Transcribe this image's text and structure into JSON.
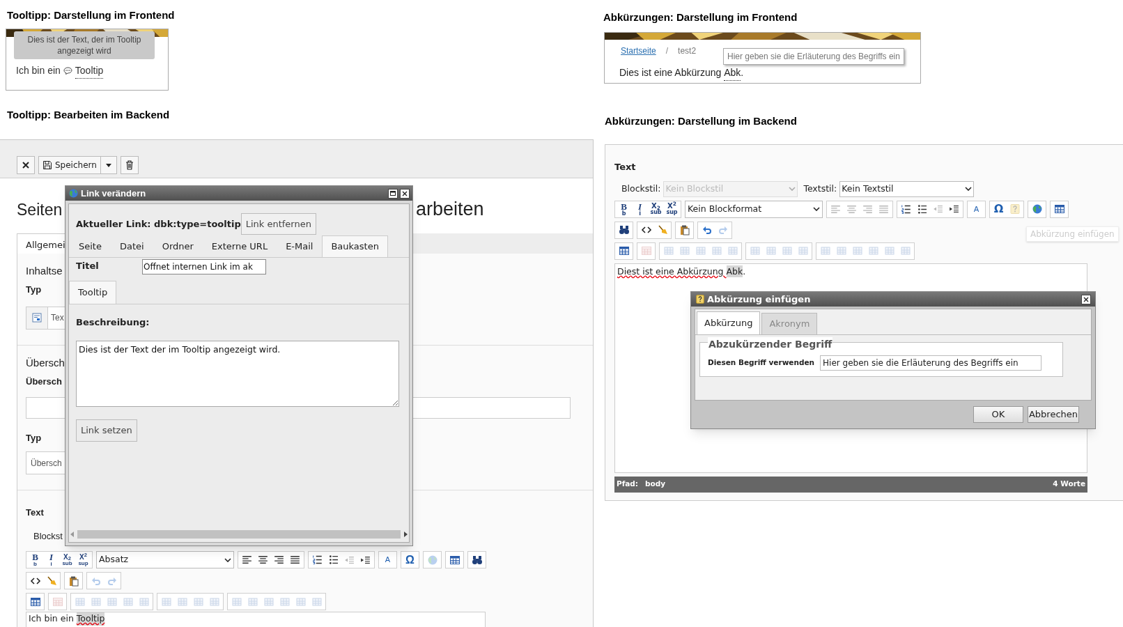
{
  "tooltip_frontend": {
    "heading": "Tooltipp: Darstellung im Frontend",
    "tooltip": "Dies ist der Text, der im Tooltip angezeigt wird",
    "text": "Ich bin ein",
    "link": "Tooltip"
  },
  "tooltip_backend": {
    "heading": "Tooltipp: Bearbeiten im Backend",
    "save_label": "Speichern",
    "page_title_start": "Seiten",
    "page_title_end": "arbeiten",
    "tab": "Allgemei",
    "section_1_title": "Inhaltse",
    "type_label": "Typ",
    "type_value": "Tex",
    "section_2_title": "Übersch",
    "header_label": "Übersch",
    "type_label_2": "Typ",
    "type_value_2": "Übersch",
    "text_label": "Text",
    "blockstyle_label": "Blockst",
    "toolbar": [
      [
        {
          "kind": "group",
          "buttons": [
            {
              "kind": "bold",
              "label": "B",
              "sub": "b",
              "disabled": false
            },
            {
              "kind": "italic",
              "label": "I",
              "sub": "i",
              "disabled": false
            },
            {
              "kind": "subscript",
              "label": "X$_{2}$",
              "sub": "sub",
              "disabled": false
            },
            {
              "kind": "superscript",
              "label": "X$^{2}$",
              "sub": "sup",
              "disabled": false
            }
          ]
        },
        {
          "kind": "select",
          "value": "Absatz"
        },
        {
          "kind": "group",
          "buttons": [
            {
              "kind": "align-left",
              "disabled": false
            },
            {
              "kind": "align-center",
              "disabled": false
            },
            {
              "kind": "align-right",
              "disabled": false
            },
            {
              "kind": "justify",
              "disabled": false
            }
          ]
        },
        {
          "kind": "group",
          "buttons": [
            {
              "kind": "ordered-list",
              "disabled": false
            },
            {
              "kind": "bullet-list",
              "disabled": false
            },
            {
              "kind": "outdent",
              "disabled": true
            },
            {
              "kind": "indent",
              "disabled": false
            }
          ]
        },
        {
          "kind": "group",
          "buttons": [
            {
              "kind": "text-color",
              "label": "A",
              "disabled": false
            }
          ]
        },
        {
          "kind": "group",
          "buttons": [
            {
              "kind": "special-char",
              "label": "Ω",
              "disabled": false
            }
          ]
        },
        {
          "kind": "group",
          "buttons": [
            {
              "kind": "globe",
              "disabled": true
            }
          ]
        },
        {
          "kind": "group",
          "buttons": [
            {
              "kind": "table",
              "disabled": false
            }
          ]
        },
        {
          "kind": "group",
          "buttons": [
            {
              "kind": "find",
              "disabled": false
            }
          ]
        }
      ],
      [
        {
          "kind": "group",
          "buttons": [
            {
              "kind": "source",
              "disabled": false
            },
            {
              "kind": "clean",
              "disabled": false
            }
          ]
        },
        {
          "kind": "group",
          "buttons": [
            {
              "kind": "paste",
              "disabled": false
            }
          ]
        },
        {
          "kind": "group",
          "buttons": [
            {
              "kind": "undo",
              "disabled": true
            },
            {
              "kind": "redo",
              "disabled": true
            }
          ]
        }
      ],
      [
        {
          "kind": "group",
          "buttons": [
            {
              "kind": "table",
              "disabled": false
            }
          ]
        },
        {
          "kind": "group",
          "buttons": [
            {
              "kind": "table-delete",
              "disabled": true
            }
          ]
        },
        {
          "kind": "group",
          "buttons": [
            {
              "kind": "table-op",
              "disabled": true
            },
            {
              "kind": "table-op",
              "disabled": true
            },
            {
              "kind": "table-op",
              "disabled": true
            },
            {
              "kind": "table-op",
              "disabled": true
            },
            {
              "kind": "table-op",
              "disabled": true
            }
          ]
        },
        {
          "kind": "group",
          "buttons": [
            {
              "kind": "table-op",
              "disabled": true
            },
            {
              "kind": "table-op",
              "disabled": true
            },
            {
              "kind": "table-op",
              "disabled": true
            },
            {
              "kind": "table-op",
              "disabled": true
            }
          ]
        },
        {
          "kind": "group",
          "buttons": [
            {
              "kind": "table-op",
              "disabled": true
            },
            {
              "kind": "table-op",
              "disabled": true
            },
            {
              "kind": "table-op",
              "disabled": true
            },
            {
              "kind": "table-op",
              "disabled": true
            },
            {
              "kind": "table-op",
              "disabled": true
            },
            {
              "kind": "table-op",
              "disabled": true
            }
          ]
        }
      ]
    ],
    "editor_text": "Ich bin ein",
    "editor_link": "Tooltip",
    "dialog": {
      "title": "Link verändern",
      "current_link": "Aktueller Link: dbk:type=tooltip",
      "remove_button": "Link entfernen",
      "tabs": [
        {
          "label": "Seite",
          "selected": false
        },
        {
          "label": "Datei",
          "selected": false
        },
        {
          "label": "Ordner",
          "selected": false
        },
        {
          "label": "Externe URL",
          "selected": false
        },
        {
          "label": "E-Mail",
          "selected": false
        },
        {
          "label": "Baukasten",
          "selected": true
        }
      ],
      "title_label": "Titel",
      "title_value": "Öffnet internen Link im ak",
      "subtabs": [
        {
          "label": "Tooltip",
          "selected": true
        }
      ],
      "description_label": "Beschreibung:",
      "description": "Dies ist der Text der im Tooltip angezeigt wird.",
      "submit": "Link setzen"
    }
  },
  "abbr_frontend": {
    "heading": "Abkürzungen: Darstellung im Frontend",
    "breadcrumb": [
      {
        "label": "Startseite",
        "kind": "link"
      },
      {
        "label": "test2",
        "kind": "current"
      }
    ],
    "separator": "/",
    "tooltip": "Hier geben sie die Erläuterung des Begriffs ein",
    "text": "Dies ist eine Abkürzung",
    "abbr": "Abk",
    "end": "."
  },
  "abbr_backend": {
    "heading": "Abkürzungen: Darstellung im Backend",
    "field_label": "Text",
    "blockstyle_label": "Blockstil:",
    "blockstyle_value": "Kein Blockstil",
    "blockstyle_disabled": true,
    "textstyle_label": "Textstil:",
    "textstyle_value": "Kein Textstil",
    "toolbar": [
      [
        {
          "kind": "group",
          "buttons": [
            {
              "kind": "bold",
              "label": "B",
              "sub": "b",
              "disabled": false
            },
            {
              "kind": "italic",
              "label": "I",
              "sub": "i",
              "disabled": false
            },
            {
              "kind": "subscript",
              "label": "X$_{2}$",
              "sub": "sub",
              "disabled": false
            },
            {
              "kind": "superscript",
              "label": "X$^{2}$",
              "sub": "sup",
              "disabled": false
            }
          ]
        },
        {
          "kind": "select",
          "value": "Kein Blockformat"
        },
        {
          "kind": "group",
          "buttons": [
            {
              "kind": "align-left",
              "disabled": true
            },
            {
              "kind": "align-center",
              "disabled": true
            },
            {
              "kind": "align-right",
              "disabled": true
            },
            {
              "kind": "justify",
              "disabled": true
            }
          ]
        },
        {
          "kind": "group",
          "buttons": [
            {
              "kind": "ordered-list",
              "disabled": false
            },
            {
              "kind": "bullet-list",
              "disabled": false
            },
            {
              "kind": "outdent",
              "disabled": true
            },
            {
              "kind": "indent",
              "disabled": false
            }
          ]
        },
        {
          "kind": "group",
          "buttons": [
            {
              "kind": "text-color",
              "label": "A",
              "disabled": false
            }
          ]
        },
        {
          "kind": "group",
          "buttons": [
            {
              "kind": "special-char",
              "label": "Ω",
              "disabled": false
            },
            {
              "kind": "abbreviation",
              "disabled": true
            }
          ]
        },
        {
          "kind": "group",
          "buttons": [
            {
              "kind": "globe",
              "disabled": false
            }
          ]
        },
        {
          "kind": "group",
          "buttons": [
            {
              "kind": "table",
              "disabled": false
            }
          ]
        }
      ],
      [
        {
          "kind": "group",
          "buttons": [
            {
              "kind": "find",
              "disabled": false
            }
          ]
        },
        {
          "kind": "group",
          "buttons": [
            {
              "kind": "source",
              "disabled": false
            },
            {
              "kind": "clean",
              "disabled": false
            }
          ]
        },
        {
          "kind": "group",
          "buttons": [
            {
              "kind": "paste",
              "disabled": false
            }
          ]
        },
        {
          "kind": "group",
          "buttons": [
            {
              "kind": "undo",
              "disabled": false
            },
            {
              "kind": "redo",
              "disabled": true
            }
          ]
        }
      ],
      [
        {
          "kind": "group",
          "buttons": [
            {
              "kind": "table",
              "disabled": false
            }
          ]
        },
        {
          "kind": "group",
          "buttons": [
            {
              "kind": "table-delete",
              "disabled": true
            }
          ]
        },
        {
          "kind": "group",
          "buttons": [
            {
              "kind": "table-op",
              "disabled": true
            },
            {
              "kind": "table-op",
              "disabled": true
            },
            {
              "kind": "table-op",
              "disabled": true
            },
            {
              "kind": "table-op",
              "disabled": true
            },
            {
              "kind": "table-op",
              "disabled": true
            }
          ]
        },
        {
          "kind": "group",
          "buttons": [
            {
              "kind": "table-op",
              "disabled": true
            },
            {
              "kind": "table-op",
              "disabled": true
            },
            {
              "kind": "table-op",
              "disabled": true
            },
            {
              "kind": "table-op",
              "disabled": true
            }
          ]
        },
        {
          "kind": "group",
          "buttons": [
            {
              "kind": "table-op",
              "disabled": true
            },
            {
              "kind": "table-op",
              "disabled": true
            },
            {
              "kind": "table-op",
              "disabled": true
            },
            {
              "kind": "table-op",
              "disabled": true
            },
            {
              "kind": "table-op",
              "disabled": true
            },
            {
              "kind": "table-op",
              "disabled": true
            }
          ]
        }
      ]
    ],
    "hint": "Abkürzung einfügen",
    "editor_text": "Diest ist eine Abkürzung",
    "editor_abbr": "Abk",
    "editor_end": ".",
    "path_label": "Pfad:",
    "path": "body",
    "word_count": "4 Worte",
    "dialog": {
      "title": "Abkürzung einfügen",
      "tabs": [
        {
          "label": "Abkürzung",
          "selected": true
        },
        {
          "label": "Akronym",
          "selected": false
        }
      ],
      "legend": "Abzukürzender Begriff",
      "field_label": "Diesen Begriff verwenden",
      "field_value": "Hier geben sie die Erläuterung des Begriffs ein",
      "buttons": [
        "OK",
        "Abbrechen"
      ]
    }
  }
}
